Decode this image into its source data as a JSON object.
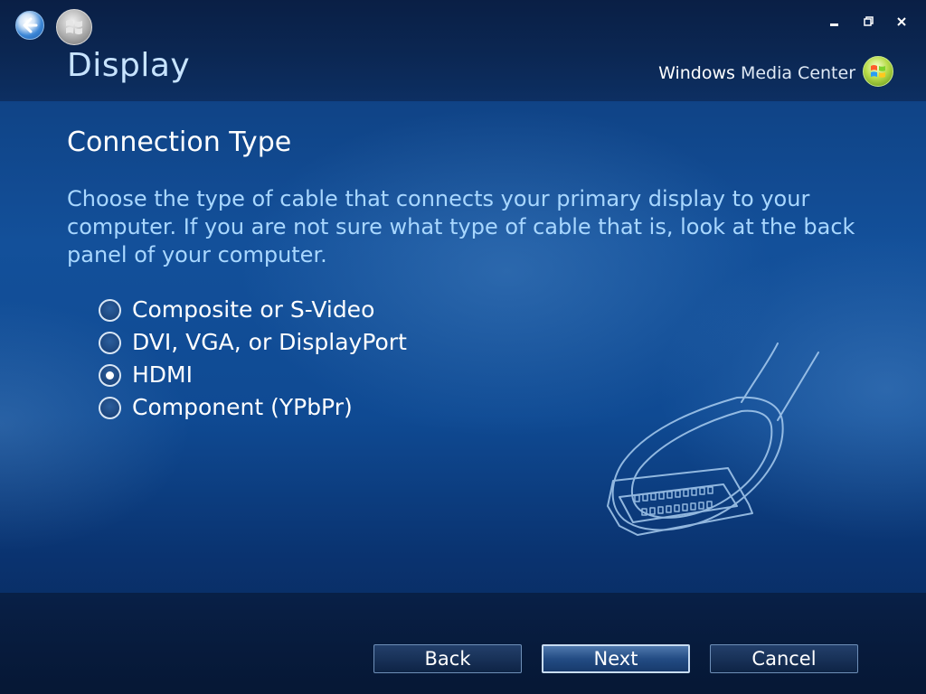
{
  "window": {
    "title": "Display",
    "controls": {
      "minimize_icon": "minimize-icon",
      "restore_icon": "restore-icon",
      "close_icon": "close-icon"
    }
  },
  "nav": {
    "back_icon": "back-arrow-icon",
    "start_icon": "windows-start-icon"
  },
  "brand": {
    "name_bold": "Windows",
    "name_light": " Media Center"
  },
  "content": {
    "section_title": "Connection Type",
    "description": "Choose the type of cable that connects your primary display to your computer. If you are not sure what type of cable that is, look at the back panel of your computer.",
    "options": [
      {
        "label": "Composite or S-Video",
        "selected": false
      },
      {
        "label": "DVI, VGA, or DisplayPort",
        "selected": false
      },
      {
        "label": "HDMI",
        "selected": true
      },
      {
        "label": "Component (YPbPr)",
        "selected": false
      }
    ],
    "illustration_icon": "hdmi-cable-icon"
  },
  "buttons": {
    "back_label": "Back",
    "next_label": "Next",
    "cancel_label": "Cancel"
  },
  "colors": {
    "background": "#13509a",
    "title": "#c7e3ff",
    "description": "#a8d7ff",
    "accent": "#c8dcf2"
  }
}
